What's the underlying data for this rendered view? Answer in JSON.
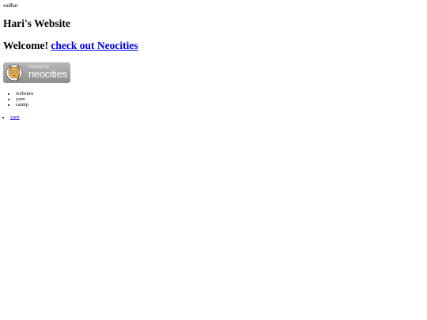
{
  "header": {
    "label": "sudhar",
    "title": "Hari's Website"
  },
  "welcome": {
    "text": "Welcome!",
    "link_text": "check out Neocities"
  },
  "badge": {
    "hosted_text": "hosted by",
    "brand_text": "neocities",
    "icon": "neocities-cat-icon"
  },
  "menu": {
    "items": [
      "websites",
      "yarn",
      "catnip"
    ]
  },
  "links": {
    "items": [
      "yarn"
    ]
  }
}
